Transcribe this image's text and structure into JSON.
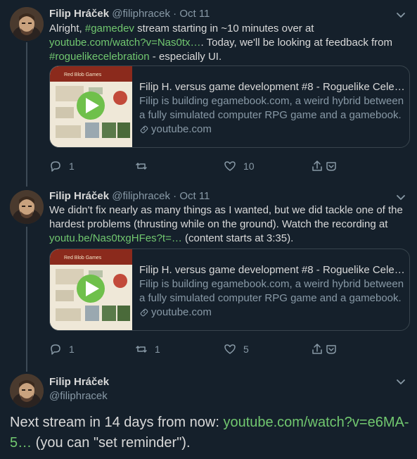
{
  "tweets": [
    {
      "name": "Filip Hráček",
      "handle": "@filiphracek",
      "sep": "·",
      "date": "Oct 11",
      "text": {
        "t1": "Alright, ",
        "l1": "#gamedev",
        "t2": " stream starting in ~10 minutes over at ",
        "l2": "youtube.com/watch?v=Nas0tx…",
        "t3": ". Today, we'll be looking at feedback from ",
        "l3": "#roguelikecelebration",
        "t4": " - especially UI."
      },
      "card": {
        "title": "Filip H. versus game development #8 - Roguelike Celebr…",
        "desc": "Filip is building egamebook.com, a weird hybrid between a fully simulated computer RPG game and a gamebook. Th…",
        "domain": "youtube.com",
        "thumb_title": "Red Blob Games"
      },
      "replies": "1",
      "retweets": "",
      "likes": "10"
    },
    {
      "name": "Filip Hráček",
      "handle": "@filiphracek",
      "sep": "·",
      "date": "Oct 11",
      "text": {
        "t1": "We didn't fix nearly as many things as I wanted, but we did tackle one of the hardest problems (thrusting while on the ground). Watch the recording at ",
        "l1": "youtu.be/Nas0txgHFes?t=…",
        "t2": " (content starts at 3:35)."
      },
      "card": {
        "title": "Filip H. versus game development #8 - Roguelike Celebr…",
        "desc": "Filip is building egamebook.com, a weird hybrid between a fully simulated computer RPG game and a gamebook. Th…",
        "domain": "youtube.com",
        "thumb_title": "Red Blob Games"
      },
      "replies": "1",
      "retweets": "1",
      "likes": "5"
    }
  ],
  "main_tweet": {
    "name": "Filip Hráček",
    "handle": "@filiphracek",
    "t1": "Next stream in 14 days from now: ",
    "l1": "youtube.com/watch?v=e6MA-5…",
    "t2": " (you can \"set reminder\")."
  },
  "icons": {
    "reply": "reply-icon",
    "retweet": "retweet-icon",
    "like": "heart-icon",
    "share": "share-icon",
    "more": "chevron-down-icon",
    "play": "play-icon",
    "link": "link-icon"
  },
  "colors": {
    "background": "#15202b",
    "link": "#71c76f",
    "secondary_text": "#8899a6",
    "primary_text": "#d9d9d9",
    "border": "#38444d"
  }
}
